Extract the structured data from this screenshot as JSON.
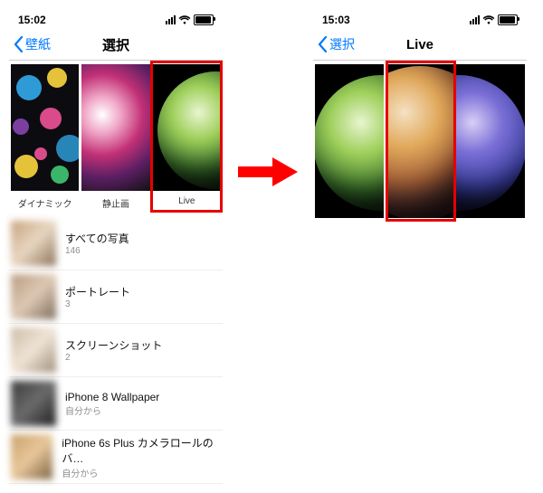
{
  "left": {
    "status_time": "15:02",
    "back_label": "壁紙",
    "title": "選択",
    "categories": [
      {
        "label": "ダイナミック"
      },
      {
        "label": "静止画"
      },
      {
        "label": "Live"
      }
    ],
    "albums": [
      {
        "name": "すべての写真",
        "count": "146"
      },
      {
        "name": "ポートレート",
        "count": "3"
      },
      {
        "name": "スクリーンショット",
        "count": "2"
      },
      {
        "name": "iPhone 8 Wallpaper",
        "count": "自分から"
      },
      {
        "name": "iPhone 6s Plus カメラロールのバ…",
        "count": "自分から"
      }
    ]
  },
  "right": {
    "status_time": "15:03",
    "back_label": "選択",
    "title": "Live"
  },
  "colors": {
    "highlight": "#e60000",
    "ios_blue": "#007aff"
  }
}
